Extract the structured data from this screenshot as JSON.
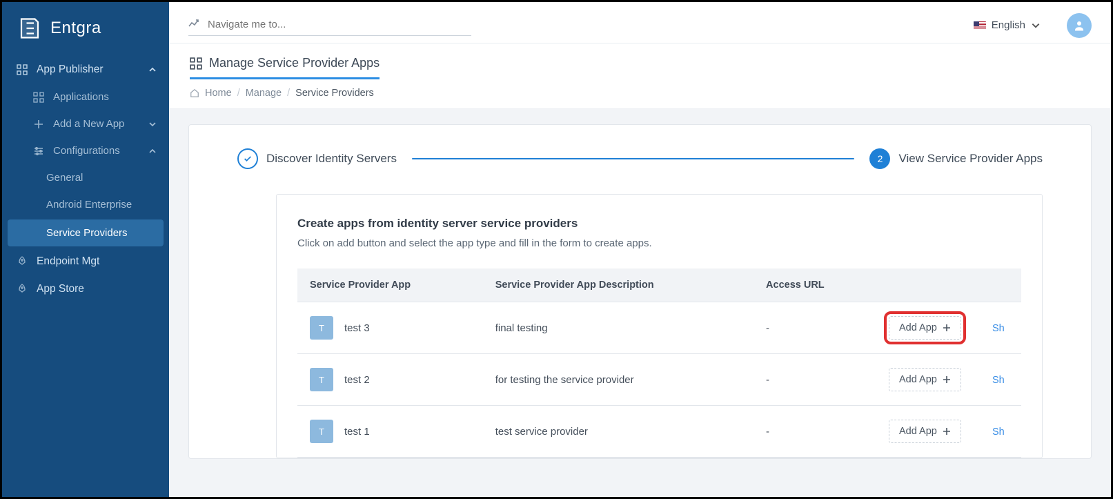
{
  "brand": {
    "name": "Entgra"
  },
  "topbar": {
    "navigate_placeholder": "Navigate me to...",
    "language": "English"
  },
  "sidebar": {
    "app_publisher": "App Publisher",
    "applications": "Applications",
    "add_new_app": "Add a New App",
    "configurations": "Configurations",
    "general": "General",
    "android_enterprise": "Android Enterprise",
    "service_providers": "Service Providers",
    "endpoint_mgt": "Endpoint Mgt",
    "app_store": "App Store"
  },
  "page": {
    "title": "Manage Service Provider Apps",
    "breadcrumb": {
      "home": "Home",
      "manage": "Manage",
      "current": "Service Providers"
    }
  },
  "steps": {
    "one_label": "Discover Identity Servers",
    "two_number": "2",
    "two_label": "View Service Provider Apps"
  },
  "panel": {
    "title": "Create apps from identity server service providers",
    "desc": "Click on add button and select the app type and fill in the form to create apps."
  },
  "table": {
    "headers": {
      "name": "Service Provider App",
      "desc": "Service Provider App Description",
      "url": "Access URL"
    },
    "add_label": "Add App",
    "show_label": "Sh",
    "rows": [
      {
        "badge": "T",
        "name": "test 3",
        "desc": "final testing",
        "url": "-"
      },
      {
        "badge": "T",
        "name": "test 2",
        "desc": "for testing the service provider",
        "url": "-"
      },
      {
        "badge": "T",
        "name": "test 1",
        "desc": "test service provider",
        "url": "-"
      }
    ]
  }
}
